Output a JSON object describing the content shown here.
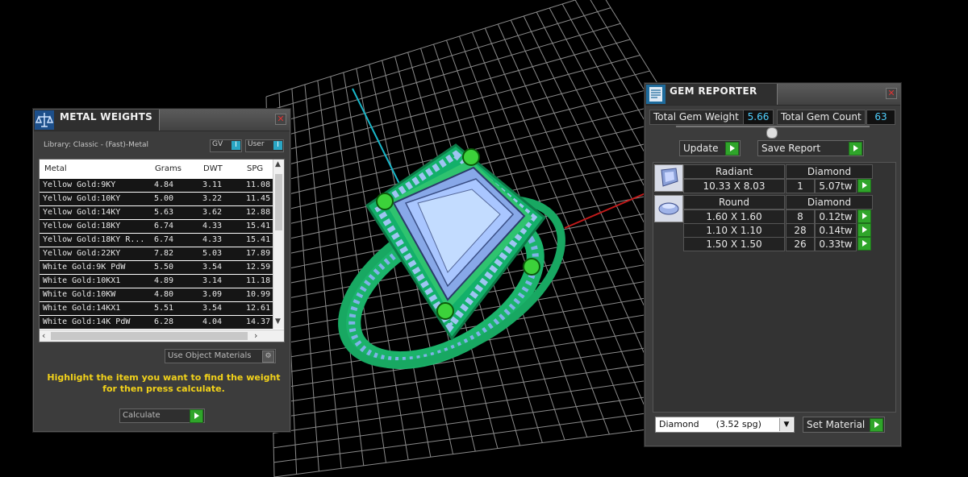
{
  "metal_weights": {
    "title": "METAL WEIGHTS",
    "library": "Library: Classic - (Fast)-Metal",
    "gv_label": "GV",
    "user_label": "User",
    "toggle_indicator": "I",
    "columns": [
      "Metal",
      "Grams",
      "DWT",
      "SPG"
    ],
    "rows": [
      {
        "metal": "Yellow Gold:9KY",
        "grams": "4.84",
        "dwt": "3.11",
        "spg": "11.08"
      },
      {
        "metal": "Yellow Gold:10KY",
        "grams": "5.00",
        "dwt": "3.22",
        "spg": "11.45"
      },
      {
        "metal": "Yellow Gold:14KY",
        "grams": "5.63",
        "dwt": "3.62",
        "spg": "12.88"
      },
      {
        "metal": "Yellow Gold:18KY",
        "grams": "6.74",
        "dwt": "4.33",
        "spg": "15.41"
      },
      {
        "metal": "Yellow Gold:18KY R...",
        "grams": "6.74",
        "dwt": "4.33",
        "spg": "15.41"
      },
      {
        "metal": "Yellow Gold:22KY",
        "grams": "7.82",
        "dwt": "5.03",
        "spg": "17.89"
      },
      {
        "metal": "White Gold:9K PdW",
        "grams": "5.50",
        "dwt": "3.54",
        "spg": "12.59"
      },
      {
        "metal": "White Gold:10KX1",
        "grams": "4.89",
        "dwt": "3.14",
        "spg": "11.18"
      },
      {
        "metal": "White Gold:10KW",
        "grams": "4.80",
        "dwt": "3.09",
        "spg": "10.99"
      },
      {
        "metal": "White Gold:14KX1",
        "grams": "5.51",
        "dwt": "3.54",
        "spg": "12.61"
      },
      {
        "metal": "White Gold:14K PdW",
        "grams": "6.28",
        "dwt": "4.04",
        "spg": "14.37"
      }
    ],
    "use_object_materials": "Use Object Materials",
    "instruction": "Highlight the item you want to find the weight for then press calculate.",
    "calculate_label": "Calculate"
  },
  "gem_reporter": {
    "title": "GEM REPORTER",
    "total_weight_label": "Total Gem Weight",
    "total_weight_value": "5.66",
    "total_count_label": "Total Gem Count",
    "total_count_value": "63",
    "update_label": "Update",
    "save_report_label": "Save Report",
    "groups": [
      {
        "icon": "radiant-gem-icon",
        "shape": "Radiant",
        "material": "Diamond",
        "items": [
          {
            "size": "10.33 X 8.03",
            "count": "1",
            "weight": "5.07tw"
          }
        ]
      },
      {
        "icon": "round-gem-icon",
        "shape": "Round",
        "material": "Diamond",
        "items": [
          {
            "size": "1.60 X 1.60",
            "count": "8",
            "weight": "0.12tw"
          },
          {
            "size": "1.10 X 1.10",
            "count": "28",
            "weight": "0.14tw"
          },
          {
            "size": "1.50 X 1.50",
            "count": "26",
            "weight": "0.33tw"
          }
        ]
      }
    ],
    "material_select": "Diamond      (3.52 spg)",
    "set_material_label": "Set Material"
  },
  "colors": {
    "accent_green": "#2fa52a",
    "value_cyan": "#4fd0ff",
    "instruction_yellow": "#f2d21a",
    "ring_green": "#1fc070",
    "gem_blue": "#8ab4ff"
  }
}
